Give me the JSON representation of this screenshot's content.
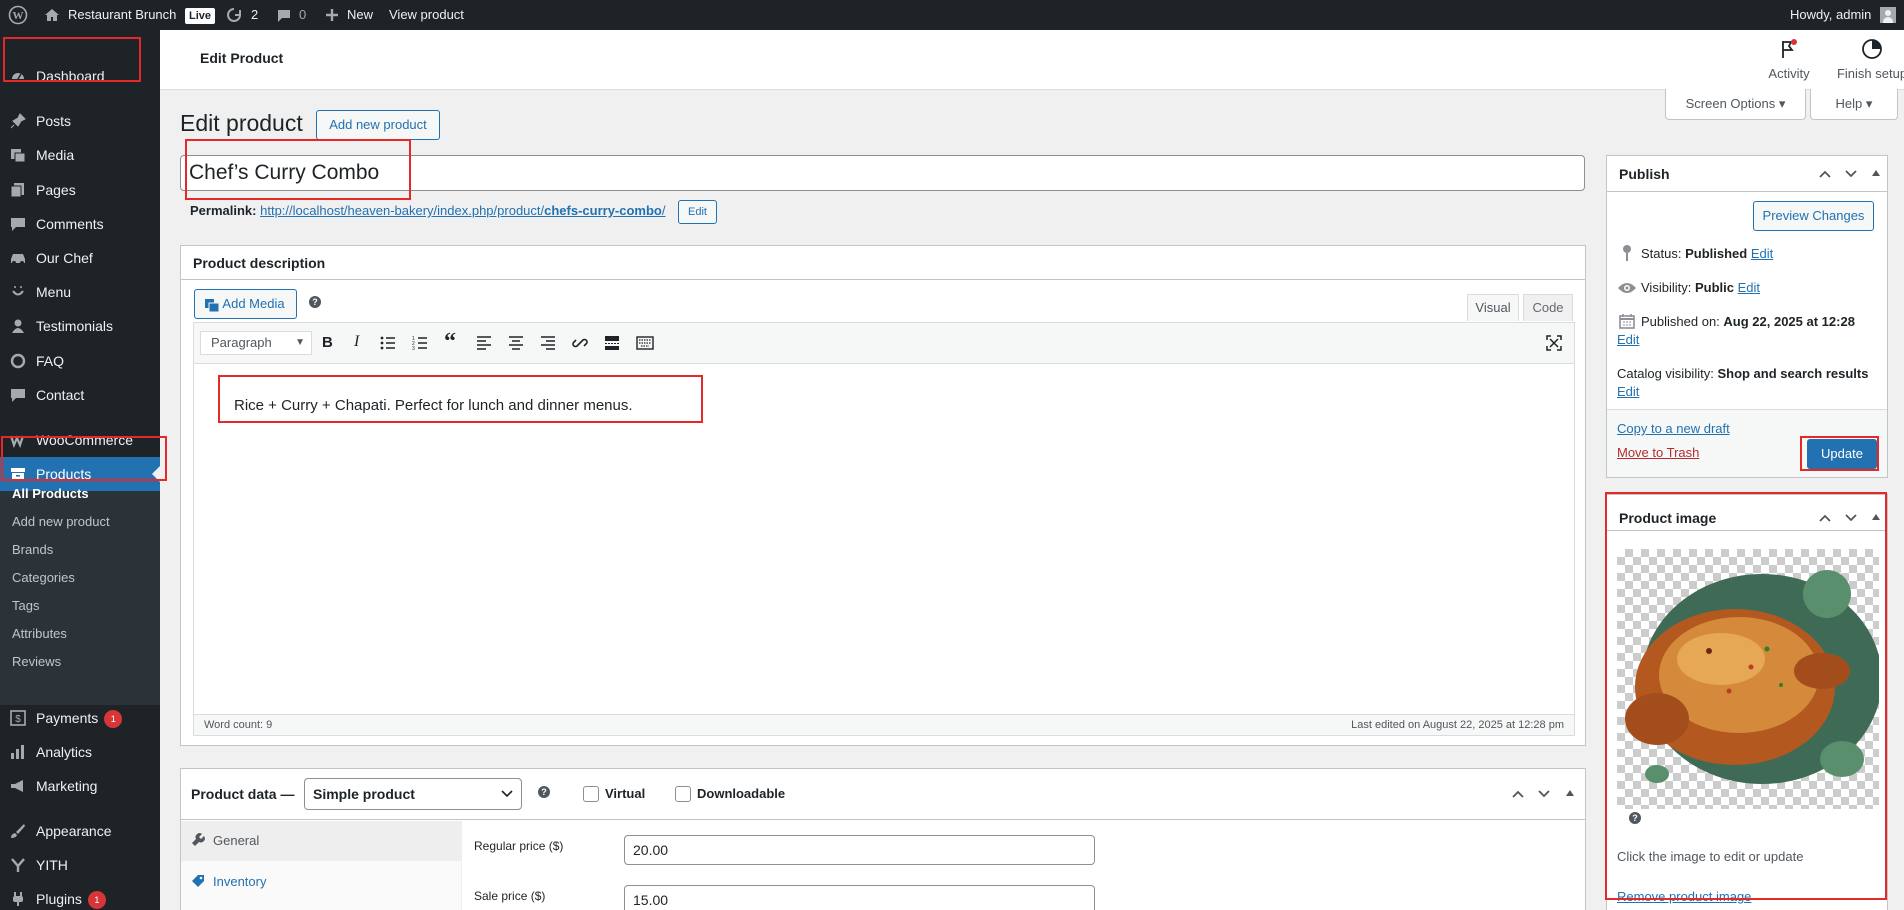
{
  "adminbar": {
    "site_name": "Restaurant Brunch",
    "live_badge": "Live",
    "updates_count": "2",
    "comments_count": "0",
    "new_label": "New",
    "view_product_label": "View product",
    "howdy": "Howdy, admin"
  },
  "sidebar": {
    "dashboard": "Dashboard",
    "posts": "Posts",
    "media": "Media",
    "pages": "Pages",
    "comments": "Comments",
    "our_chef": "Our Chef",
    "menu": "Menu",
    "testimonials": "Testimonials",
    "faq": "FAQ",
    "contact": "Contact",
    "woocommerce": "WooCommerce",
    "products": "Products",
    "submenu": [
      "All Products",
      "Add new product",
      "Brands",
      "Categories",
      "Tags",
      "Attributes",
      "Reviews"
    ],
    "payments": "Payments",
    "payments_badge": "1",
    "analytics": "Analytics",
    "marketing": "Marketing",
    "appearance": "Appearance",
    "yith": "YITH",
    "plugins": "Plugins",
    "plugins_badge": "1"
  },
  "topbar": {
    "title": "Edit Product",
    "activity": "Activity",
    "finish_setup": "Finish setup"
  },
  "screen_options": "Screen Options",
  "help": "Help",
  "page": {
    "heading": "Edit product",
    "add_new": "Add new product",
    "post_title": "Chef’s Curry Combo",
    "permalink_label": "Permalink:",
    "permalink_base": "http://localhost/heaven-bakery/index.php/product/",
    "permalink_slug": "chefs-curry-combo",
    "permalink_trail": "/",
    "permalink_edit": "Edit"
  },
  "description": {
    "title": "Product description",
    "add_media": "Add Media",
    "tab_visual": "Visual",
    "tab_code": "Code",
    "format_select": "Paragraph",
    "content": "Rice + Curry + Chapati. Perfect for lunch and dinner menus.",
    "word_count": "Word count: 9",
    "last_edited": "Last edited on August 22, 2025 at 12:28 pm"
  },
  "product_data": {
    "title": "Product data —",
    "type": "Simple product",
    "virtual": "Virtual",
    "downloadable": "Downloadable",
    "tabs": [
      "General",
      "Inventory"
    ],
    "regular_price_label": "Regular price ($)",
    "regular_price": "20.00",
    "sale_price_label": "Sale price ($)",
    "sale_price": "15.00"
  },
  "publish": {
    "title": "Publish",
    "preview": "Preview Changes",
    "status_label": "Status:",
    "status_value": "Published",
    "visibility_label": "Visibility:",
    "visibility_value": "Public",
    "published_label": "Published on:",
    "published_value": "Aug 22, 2025 at 12:28",
    "catalog_label": "Catalog visibility:",
    "catalog_value": "Shop and search results",
    "edit": "Edit",
    "copy_draft": "Copy to a new draft",
    "trash": "Move to Trash",
    "update": "Update"
  },
  "product_image": {
    "title": "Product image",
    "hint": "Click the image to edit or update",
    "remove": "Remove product image"
  },
  "colors": {
    "primary": "#2271b1",
    "annotation": "#e52828",
    "sidebar": "#1d2327"
  }
}
